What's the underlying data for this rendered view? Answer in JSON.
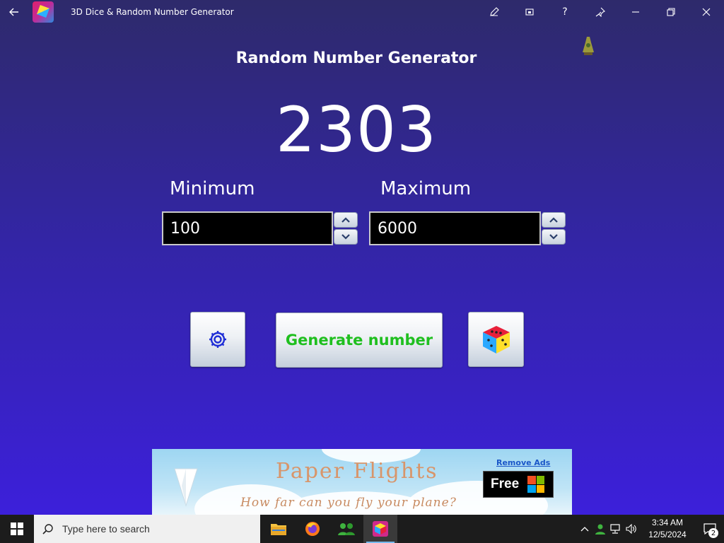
{
  "window": {
    "title": "3D Dice & Random Number Generator"
  },
  "app": {
    "heading": "Random Number Generator",
    "result": "2303",
    "minimum": {
      "label": "Minimum",
      "value": "100"
    },
    "maximum": {
      "label": "Maximum",
      "value": "6000"
    },
    "generate_label": "Generate number",
    "icons": {
      "settings": "gear-icon",
      "dice": "dice-icon"
    }
  },
  "ad": {
    "title": "Paper Flights",
    "subtitle": "How far can you fly your plane?",
    "remove_ads": "Remove Ads",
    "free_label": "Free"
  },
  "taskbar": {
    "search_placeholder": "Type here to search",
    "time": "3:34 AM",
    "date": "12/5/2024",
    "notification_count": "2"
  },
  "colors": {
    "generate_text": "#1fbf1f",
    "background_top": "#2e2a6b",
    "background_bottom": "#3d1fe0"
  }
}
